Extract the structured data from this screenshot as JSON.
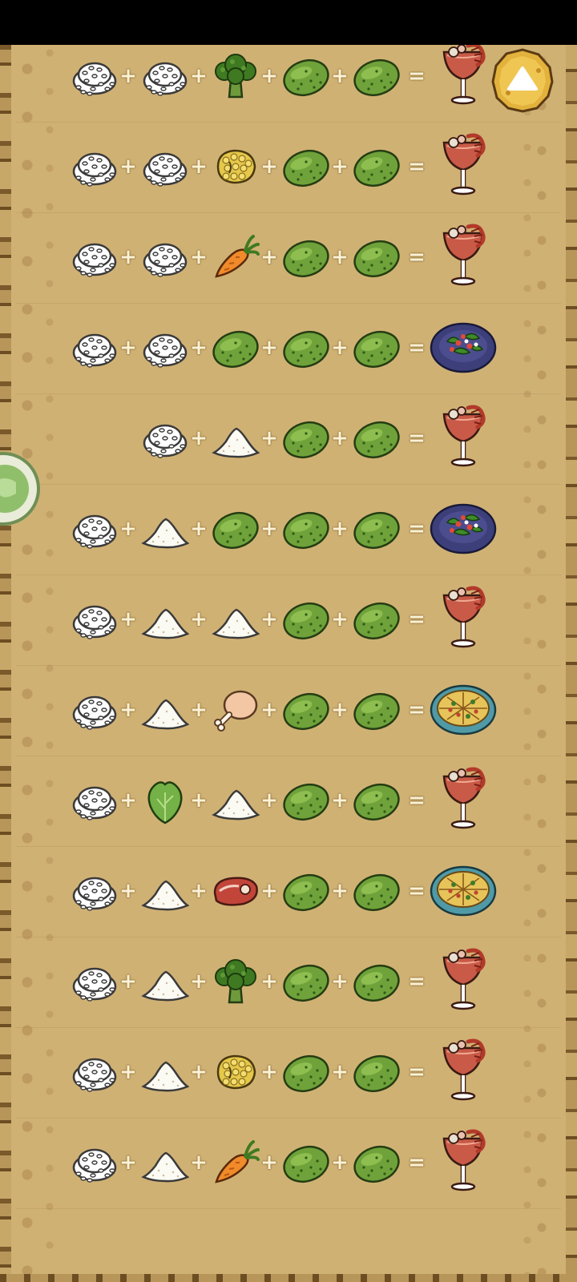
{
  "screen": {
    "title": "",
    "colors": {
      "parchment": "#d0b174",
      "border": "#6d4e22",
      "operator": "#fbf2d6",
      "scroll_button": "#e2b23c"
    }
  },
  "controls": {
    "scroll_up_icon": "triangle-up-icon",
    "side_tab_icon": "chat-bubble-icon"
  },
  "operators": {
    "plus": "+",
    "equals": "="
  },
  "recipes": [
    {
      "ingredients": [
        "rice",
        "rice",
        "broccoli",
        "cucumber",
        "cucumber"
      ],
      "result": "seafood-cocktail"
    },
    {
      "ingredients": [
        "rice",
        "rice",
        "corn",
        "cucumber",
        "cucumber"
      ],
      "result": "seafood-cocktail"
    },
    {
      "ingredients": [
        "rice",
        "rice",
        "carrot",
        "cucumber",
        "cucumber"
      ],
      "result": "seafood-cocktail"
    },
    {
      "ingredients": [
        "rice",
        "rice",
        "cucumber",
        "cucumber",
        "cucumber"
      ],
      "result": "salad-plate"
    },
    {
      "ingredients": [
        null,
        "rice",
        "flour",
        "cucumber",
        "cucumber"
      ],
      "result": "seafood-cocktail"
    },
    {
      "ingredients": [
        "rice",
        "flour",
        "cucumber",
        "cucumber",
        "cucumber"
      ],
      "result": "salad-plate"
    },
    {
      "ingredients": [
        "rice",
        "flour",
        "flour",
        "cucumber",
        "cucumber"
      ],
      "result": "seafood-cocktail"
    },
    {
      "ingredients": [
        "rice",
        "flour",
        "drumstick",
        "cucumber",
        "cucumber"
      ],
      "result": "pizza-plate"
    },
    {
      "ingredients": [
        "rice",
        "lettuce",
        "flour",
        "cucumber",
        "cucumber"
      ],
      "result": "seafood-cocktail"
    },
    {
      "ingredients": [
        "rice",
        "flour",
        "steak",
        "cucumber",
        "cucumber"
      ],
      "result": "pizza-plate"
    },
    {
      "ingredients": [
        "rice",
        "flour",
        "broccoli",
        "cucumber",
        "cucumber"
      ],
      "result": "seafood-cocktail"
    },
    {
      "ingredients": [
        "rice",
        "flour",
        "corn",
        "cucumber",
        "cucumber"
      ],
      "result": "seafood-cocktail"
    },
    {
      "ingredients": [
        "rice",
        "flour",
        "carrot",
        "cucumber",
        "cucumber"
      ],
      "result": "seafood-cocktail"
    }
  ]
}
